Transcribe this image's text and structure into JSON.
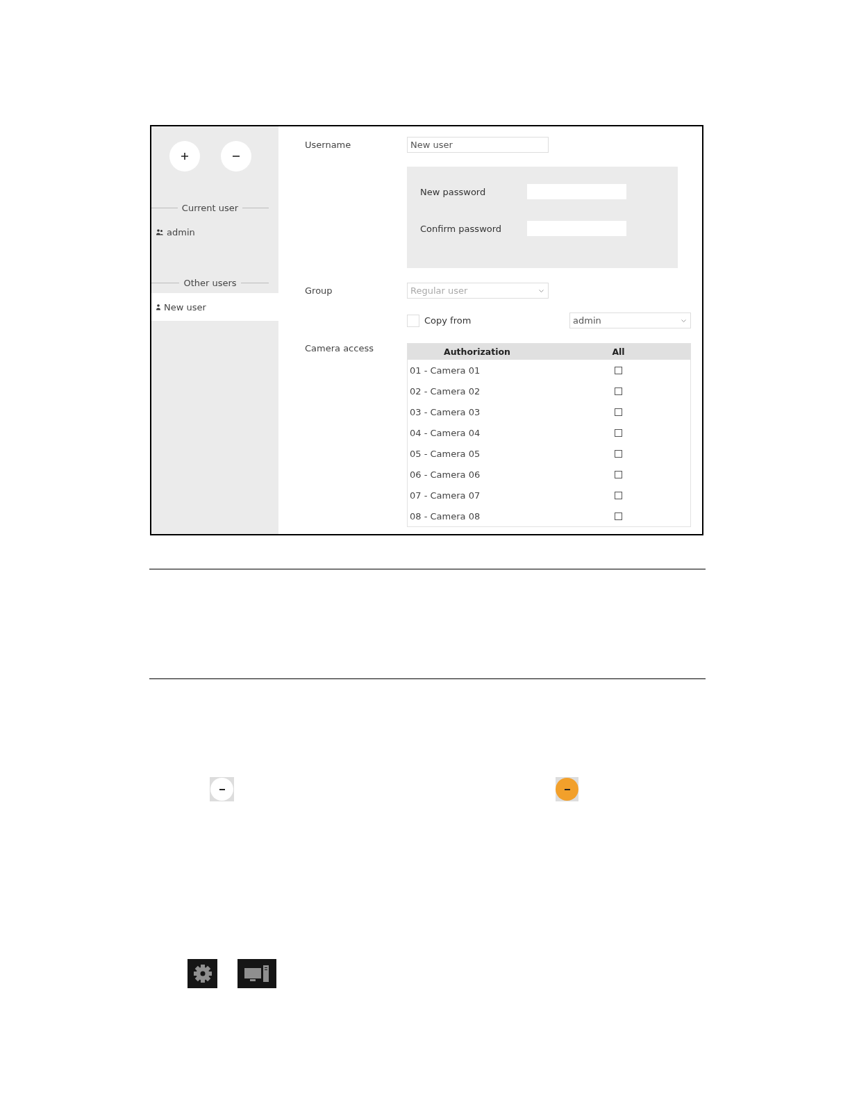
{
  "sidebar": {
    "sections": [
      {
        "title": "Current user",
        "users": [
          {
            "name": "admin",
            "kind": "group",
            "selected": false
          }
        ]
      },
      {
        "title": "Other users",
        "users": [
          {
            "name": "New user",
            "kind": "single",
            "selected": true
          }
        ]
      }
    ]
  },
  "form": {
    "username": {
      "label": "Username",
      "value": "New user"
    },
    "password_fields": [
      {
        "label": "New password"
      },
      {
        "label": "Confirm password"
      }
    ],
    "group": {
      "label": "Group",
      "value": "Regular user",
      "disabled": true
    },
    "copy_from": {
      "label": "Copy from",
      "checked": false,
      "value": "admin"
    },
    "camera_access": {
      "label": "Camera access",
      "columns": [
        "Authorization",
        "All"
      ],
      "rows": [
        {
          "name": "01 - Camera 01",
          "checked": false
        },
        {
          "name": "02 - Camera 02",
          "checked": false
        },
        {
          "name": "03 - Camera 03",
          "checked": false
        },
        {
          "name": "04 - Camera 04",
          "checked": false
        },
        {
          "name": "05 - Camera 05",
          "checked": false
        },
        {
          "name": "06 - Camera 06",
          "checked": false
        },
        {
          "name": "07 - Camera 07",
          "checked": false
        },
        {
          "name": "08 - Camera 08",
          "checked": false
        }
      ]
    }
  },
  "remove_button_states": [
    {
      "selected": false
    },
    {
      "selected": true
    }
  ],
  "bottom_icons": [
    {
      "kind": "gear"
    },
    {
      "kind": "computer"
    }
  ]
}
